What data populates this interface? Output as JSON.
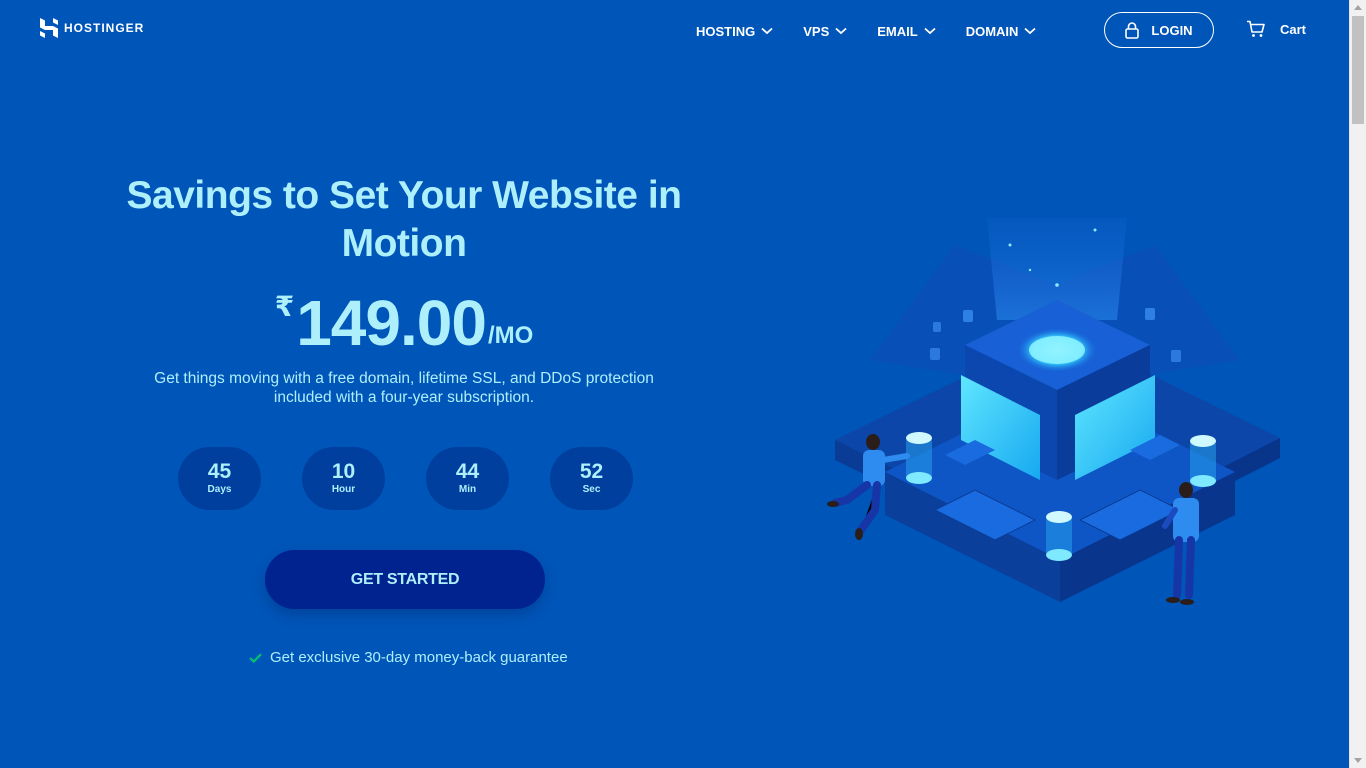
{
  "brand": {
    "name": "HOSTINGER",
    "icon": "hostinger-logo-icon"
  },
  "nav": {
    "items": [
      {
        "label": "HOSTING",
        "icon": "chevron-down-icon"
      },
      {
        "label": "VPS",
        "icon": "chevron-down-icon"
      },
      {
        "label": "EMAIL",
        "icon": "chevron-down-icon"
      },
      {
        "label": "DOMAIN",
        "icon": "chevron-down-icon"
      }
    ],
    "login_label": "LOGIN",
    "login_icon": "lock-icon",
    "cart_label": "Cart",
    "cart_icon": "cart-icon"
  },
  "hero": {
    "title": "Savings to Set Your Website in Motion",
    "price": {
      "currency": "₹",
      "amount": "149.00",
      "per": "/MO"
    },
    "subtitle": "Get things moving with a free domain, lifetime SSL, and DDoS protection included with a four-year subscription.",
    "timer": [
      {
        "value": "45",
        "unit": "Days"
      },
      {
        "value": "10",
        "unit": "Hour"
      },
      {
        "value": "44",
        "unit": "Min"
      },
      {
        "value": "52",
        "unit": "Sec"
      }
    ],
    "cta_label": "GET STARTED",
    "guarantee": "Get exclusive 30-day money-back guarantee",
    "guarantee_icon": "checkmark-icon"
  },
  "colors": {
    "background": "#0055B8",
    "accent_text": "#AEEFFC",
    "timer_bg": "#003F9E",
    "cta_bg": "#00238F",
    "check": "#00C26F"
  }
}
